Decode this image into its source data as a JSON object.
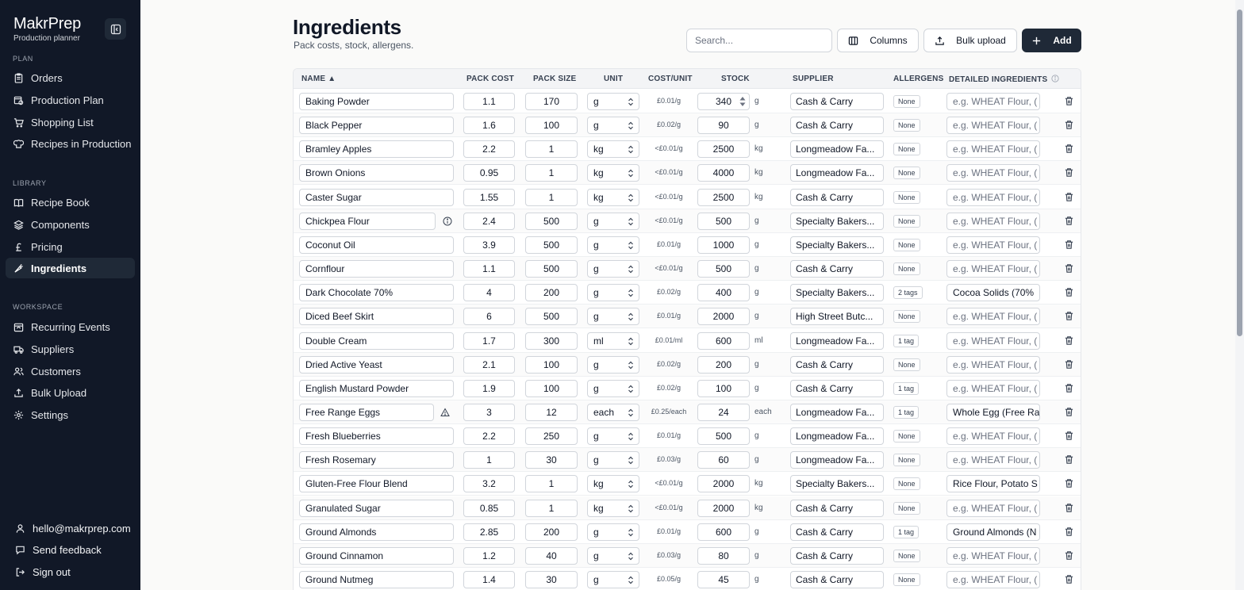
{
  "app": {
    "name": "MakrPrep",
    "subtitle": "Production planner"
  },
  "sidebar": {
    "plan_label": "PLAN",
    "plan_items": [
      {
        "label": "Orders",
        "icon": "clipboard-icon"
      },
      {
        "label": "Production Plan",
        "icon": "calendar-clock-icon"
      },
      {
        "label": "Shopping List",
        "icon": "cart-icon"
      },
      {
        "label": "Recipes in Production",
        "icon": "chef-hat-icon"
      }
    ],
    "library_label": "LIBRARY",
    "library_items": [
      {
        "label": "Recipe Book",
        "icon": "book-open-icon"
      },
      {
        "label": "Components",
        "icon": "layers-icon"
      },
      {
        "label": "Pricing",
        "icon": "pound-icon"
      },
      {
        "label": "Ingredients",
        "icon": "carrot-icon",
        "active": true
      }
    ],
    "workspace_label": "WORKSPACE",
    "workspace_items": [
      {
        "label": "Recurring Events",
        "icon": "calendar-repeat-icon"
      },
      {
        "label": "Suppliers",
        "icon": "truck-icon"
      },
      {
        "label": "Customers",
        "icon": "users-icon"
      },
      {
        "label": "Bulk Upload",
        "icon": "upload-icon"
      },
      {
        "label": "Settings",
        "icon": "gear-icon"
      }
    ],
    "footer": {
      "email": "hello@makrprep.com",
      "feedback": "Send feedback",
      "signout": "Sign out"
    }
  },
  "header": {
    "title": "Ingredients",
    "subtitle": "Pack costs, stock, allergens.",
    "search_placeholder": "Search...",
    "columns_label": "Columns",
    "bulk_label": "Bulk upload",
    "add_label": "Add"
  },
  "table": {
    "columns": {
      "name": "NAME ▲",
      "pack_cost": "PACK COST",
      "pack_size": "PACK SIZE",
      "unit": "UNIT",
      "cost_unit": "COST/UNIT",
      "stock": "STOCK",
      "supplier": "SUPPLIER",
      "allergens": "ALLERGENS",
      "detailed": "DETAILED INGREDIENTS"
    },
    "detail_placeholder": "e.g. WHEAT Flour, (",
    "rows": [
      {
        "name": "Baking Powder",
        "cost": "1.1",
        "size": "170",
        "unit": "g",
        "cpu": "£0.01/g",
        "stock": "340",
        "sunit": "g",
        "supplier": "Cash & Carry",
        "allergens": "None",
        "detail": ""
      },
      {
        "name": "Black Pepper",
        "cost": "1.6",
        "size": "100",
        "unit": "g",
        "cpu": "£0.02/g",
        "stock": "90",
        "sunit": "g",
        "supplier": "Cash & Carry",
        "allergens": "None",
        "detail": ""
      },
      {
        "name": "Bramley Apples",
        "cost": "2.2",
        "size": "1",
        "unit": "kg",
        "cpu": "<£0.01/g",
        "stock": "2500",
        "sunit": "kg",
        "supplier": "Longmeadow Fa...",
        "allergens": "None",
        "detail": ""
      },
      {
        "name": "Brown Onions",
        "cost": "0.95",
        "size": "1",
        "unit": "kg",
        "cpu": "<£0.01/g",
        "stock": "4000",
        "sunit": "kg",
        "supplier": "Longmeadow Fa...",
        "allergens": "None",
        "detail": ""
      },
      {
        "name": "Caster Sugar",
        "cost": "1.55",
        "size": "1",
        "unit": "kg",
        "cpu": "<£0.01/g",
        "stock": "2500",
        "sunit": "kg",
        "supplier": "Cash & Carry",
        "allergens": "None",
        "detail": ""
      },
      {
        "name": "Chickpea Flour",
        "cost": "2.4",
        "size": "500",
        "unit": "g",
        "cpu": "<£0.01/g",
        "stock": "500",
        "sunit": "g",
        "supplier": "Specialty Bakers...",
        "allergens": "None",
        "detail": "",
        "flag": "info"
      },
      {
        "name": "Coconut Oil",
        "cost": "3.9",
        "size": "500",
        "unit": "g",
        "cpu": "£0.01/g",
        "stock": "1000",
        "sunit": "g",
        "supplier": "Specialty Bakers...",
        "allergens": "None",
        "detail": ""
      },
      {
        "name": "Cornflour",
        "cost": "1.1",
        "size": "500",
        "unit": "g",
        "cpu": "<£0.01/g",
        "stock": "500",
        "sunit": "g",
        "supplier": "Cash & Carry",
        "allergens": "None",
        "detail": ""
      },
      {
        "name": "Dark Chocolate 70%",
        "cost": "4",
        "size": "200",
        "unit": "g",
        "cpu": "£0.02/g",
        "stock": "400",
        "sunit": "g",
        "supplier": "Specialty Bakers...",
        "allergens": "2 tags",
        "detail": "Cocoa Solids (70%"
      },
      {
        "name": "Diced Beef Skirt",
        "cost": "6",
        "size": "500",
        "unit": "g",
        "cpu": "£0.01/g",
        "stock": "2000",
        "sunit": "g",
        "supplier": "High Street Butc...",
        "allergens": "None",
        "detail": ""
      },
      {
        "name": "Double Cream",
        "cost": "1.7",
        "size": "300",
        "unit": "ml",
        "cpu": "£0.01/ml",
        "stock": "600",
        "sunit": "ml",
        "supplier": "Longmeadow Fa...",
        "allergens": "1 tag",
        "detail": ""
      },
      {
        "name": "Dried Active Yeast",
        "cost": "2.1",
        "size": "100",
        "unit": "g",
        "cpu": "£0.02/g",
        "stock": "200",
        "sunit": "g",
        "supplier": "Cash & Carry",
        "allergens": "None",
        "detail": ""
      },
      {
        "name": "English Mustard Powder",
        "cost": "1.9",
        "size": "100",
        "unit": "g",
        "cpu": "£0.02/g",
        "stock": "100",
        "sunit": "g",
        "supplier": "Cash & Carry",
        "allergens": "1 tag",
        "detail": ""
      },
      {
        "name": "Free Range Eggs",
        "cost": "3",
        "size": "12",
        "unit": "each",
        "cpu": "£0.25/each",
        "stock": "24",
        "sunit": "each",
        "supplier": "Longmeadow Fa...",
        "allergens": "1 tag",
        "detail": "Whole Egg (Free Ra",
        "flag": "warn"
      },
      {
        "name": "Fresh Blueberries",
        "cost": "2.2",
        "size": "250",
        "unit": "g",
        "cpu": "£0.01/g",
        "stock": "500",
        "sunit": "g",
        "supplier": "Longmeadow Fa...",
        "allergens": "None",
        "detail": ""
      },
      {
        "name": "Fresh Rosemary",
        "cost": "1",
        "size": "30",
        "unit": "g",
        "cpu": "£0.03/g",
        "stock": "60",
        "sunit": "g",
        "supplier": "Longmeadow Fa...",
        "allergens": "None",
        "detail": ""
      },
      {
        "name": "Gluten-Free Flour Blend",
        "cost": "3.2",
        "size": "1",
        "unit": "kg",
        "cpu": "<£0.01/g",
        "stock": "2000",
        "sunit": "kg",
        "supplier": "Specialty Bakers...",
        "allergens": "None",
        "detail": "Rice Flour, Potato S"
      },
      {
        "name": "Granulated Sugar",
        "cost": "0.85",
        "size": "1",
        "unit": "kg",
        "cpu": "<£0.01/g",
        "stock": "2000",
        "sunit": "kg",
        "supplier": "Cash & Carry",
        "allergens": "None",
        "detail": ""
      },
      {
        "name": "Ground Almonds",
        "cost": "2.85",
        "size": "200",
        "unit": "g",
        "cpu": "£0.01/g",
        "stock": "600",
        "sunit": "g",
        "supplier": "Cash & Carry",
        "allergens": "1 tag",
        "detail": "Ground Almonds (N"
      },
      {
        "name": "Ground Cinnamon",
        "cost": "1.2",
        "size": "40",
        "unit": "g",
        "cpu": "£0.03/g",
        "stock": "80",
        "sunit": "g",
        "supplier": "Cash & Carry",
        "allergens": "None",
        "detail": ""
      },
      {
        "name": "Ground Nutmeg",
        "cost": "1.4",
        "size": "30",
        "unit": "g",
        "cpu": "£0.05/g",
        "stock": "45",
        "sunit": "g",
        "supplier": "Cash & Carry",
        "allergens": "None",
        "detail": ""
      }
    ]
  }
}
